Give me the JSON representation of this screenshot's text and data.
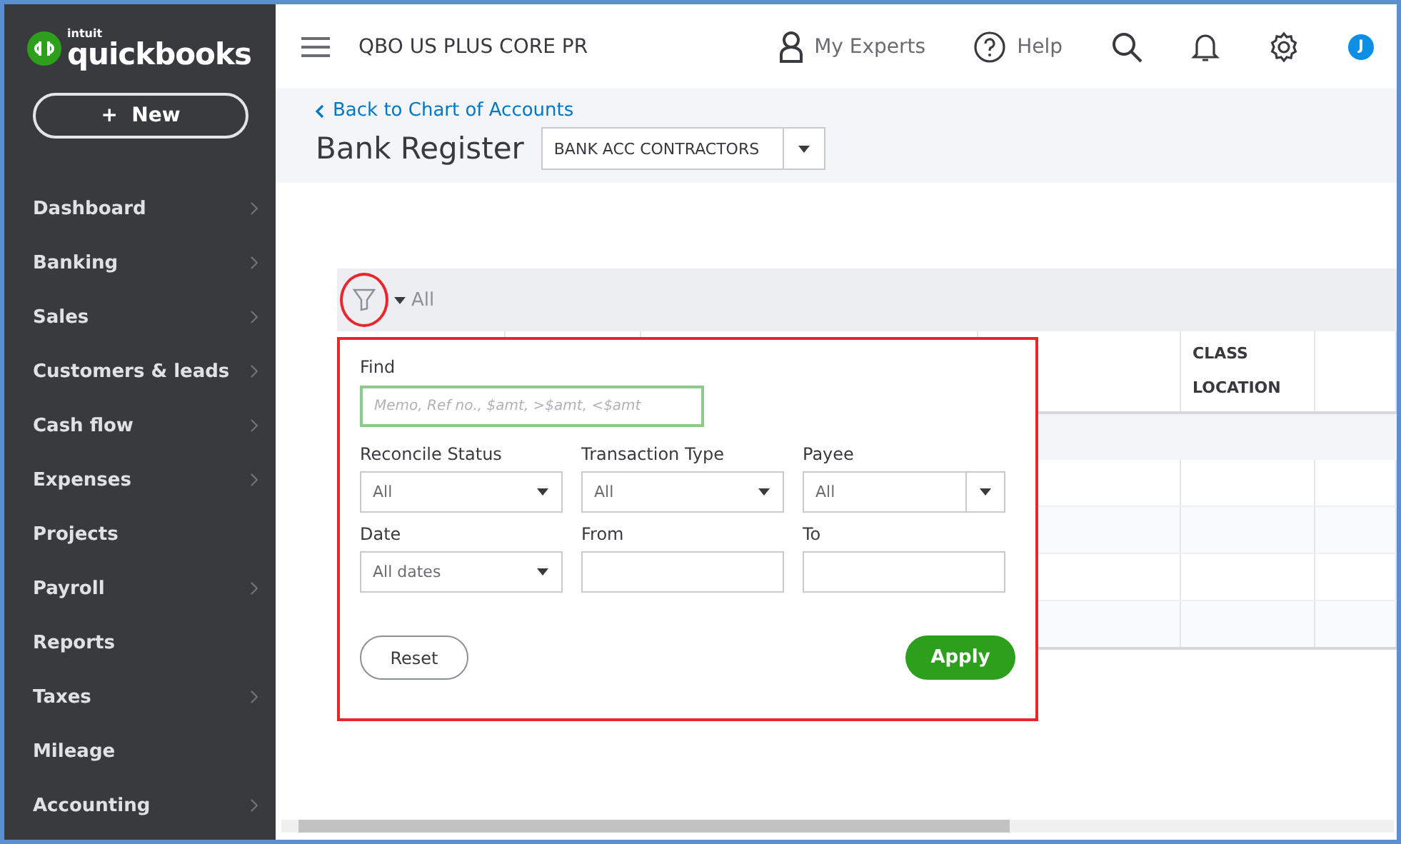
{
  "sidebar": {
    "logo_small": "intuit",
    "logo": "quickbooks",
    "new_button": "+  New",
    "items": [
      {
        "label": "Dashboard",
        "has_submenu": true
      },
      {
        "label": "Banking",
        "has_submenu": true
      },
      {
        "label": "Sales",
        "has_submenu": true
      },
      {
        "label": "Customers & leads",
        "has_submenu": true
      },
      {
        "label": "Cash flow",
        "has_submenu": true
      },
      {
        "label": "Expenses",
        "has_submenu": true
      },
      {
        "label": "Projects",
        "has_submenu": false
      },
      {
        "label": "Payroll",
        "has_submenu": true
      },
      {
        "label": "Reports",
        "has_submenu": false
      },
      {
        "label": "Taxes",
        "has_submenu": true
      },
      {
        "label": "Mileage",
        "has_submenu": false
      },
      {
        "label": "Accounting",
        "has_submenu": true
      }
    ]
  },
  "topbar": {
    "company": "QBO US PLUS CORE PR",
    "experts": "My Experts",
    "help": "Help",
    "avatar": "J"
  },
  "page": {
    "back_link": "Back to Chart of Accounts",
    "title": "Bank Register",
    "account": "BANK ACC CONTRACTORS"
  },
  "filter_bar": {
    "label": "All"
  },
  "table": {
    "header": [
      "CLASS",
      "LOCATION"
    ]
  },
  "filter_panel": {
    "find_label": "Find",
    "find_placeholder": "Memo, Ref no., $amt, >$amt, <$amt",
    "fields": [
      {
        "label": "Reconcile Status",
        "kind": "select",
        "value": "All"
      },
      {
        "label": "Transaction Type",
        "kind": "select",
        "value": "All"
      },
      {
        "label": "Payee",
        "kind": "combo",
        "value": "All"
      },
      {
        "label": "Date",
        "kind": "select",
        "value": "All dates"
      },
      {
        "label": "From",
        "kind": "input"
      },
      {
        "label": "To",
        "kind": "input"
      }
    ],
    "reset": "Reset",
    "apply": "Apply"
  }
}
